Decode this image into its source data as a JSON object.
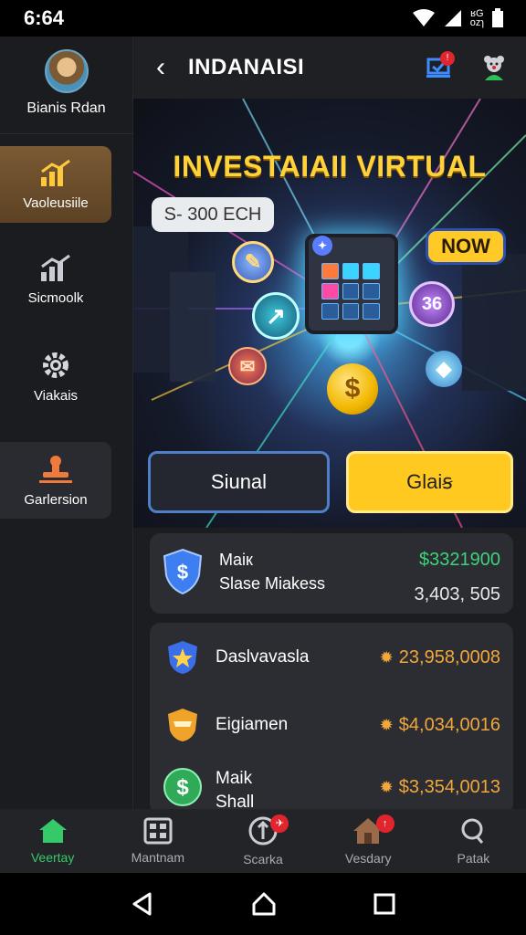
{
  "status_bar": {
    "time": "6:64",
    "network_text": "ʁG\nozɿ"
  },
  "sidebar": {
    "username": "Bianis Rdan",
    "items": [
      {
        "label": "Vaoleusiile",
        "icon": "bar-chart-up-icon"
      },
      {
        "label": "Sicmoolk",
        "icon": "trend-chart-icon"
      },
      {
        "label": "Viakais",
        "icon": "gear-icon"
      },
      {
        "label": "Garlersion",
        "icon": "stamp-icon"
      }
    ]
  },
  "header": {
    "title": "INDANAISI",
    "notify_badge": "!"
  },
  "hero": {
    "headline": "INVESTAIAII VIRTUAL",
    "price": "S- 300 ECH",
    "now_label": "NOW",
    "coin_symbol": "$",
    "orb_badge": "36"
  },
  "actions": {
    "signal_label": "Siunal",
    "goals_label": "Glaiꞩ"
  },
  "summary_card": {
    "name_line1": "Maiк",
    "name_line2": "Slase Miakess",
    "value1": "$3321900",
    "value2": "3,403, 505"
  },
  "holdings": [
    {
      "name": "Daslvavasla",
      "value": "23,958,0008",
      "icon": "star-badge-icon"
    },
    {
      "name": "Eigiamen",
      "value": "$4,034,0016",
      "icon": "shield-badge-icon"
    },
    {
      "name": "Maik\nShall",
      "value": "$3,354,0013",
      "icon": "dollar-coin-icon"
    }
  ],
  "tabs": [
    {
      "label": "Veertay",
      "icon": "home-icon",
      "active": true
    },
    {
      "label": "Mantnam",
      "icon": "grid-box-icon"
    },
    {
      "label": "Scarka",
      "icon": "compass-icon",
      "badge": "✈"
    },
    {
      "label": "Vesdary",
      "icon": "house-icon",
      "badge": "↑"
    },
    {
      "label": "Patak",
      "icon": "search-icon"
    }
  ],
  "colors": {
    "accent_gold": "#ffc91f",
    "accent_green": "#36c96a",
    "positive": "#3fd27a",
    "value_orange": "#f1a73b"
  }
}
